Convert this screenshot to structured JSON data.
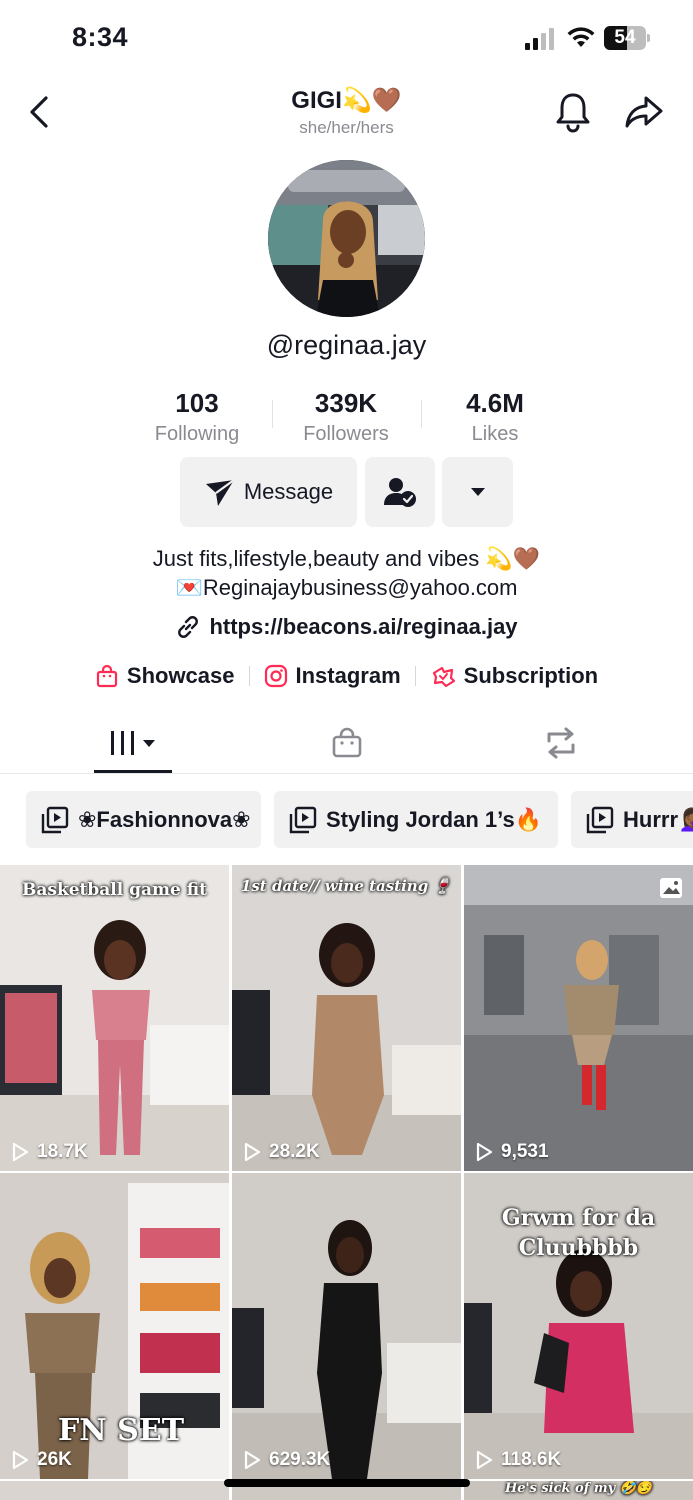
{
  "status_bar": {
    "time": "8:34",
    "battery": "54",
    "battery_level": 0.54
  },
  "header": {
    "title": "GIGI💫🤎",
    "pronouns": "she/her/hers"
  },
  "profile": {
    "username": "@reginaa.jay"
  },
  "stats": [
    {
      "value": "103",
      "label": "Following"
    },
    {
      "value": "339K",
      "label": "Followers"
    },
    {
      "value": "4.6M",
      "label": "Likes"
    }
  ],
  "actions": {
    "message_label": "Message"
  },
  "bio": {
    "line1": "Just fits,lifestyle,beauty and vibes 💫🤎",
    "line2": "💌Reginajaybusiness@yahoo.com",
    "link": "https://beacons.ai/reginaa.jay"
  },
  "links": [
    {
      "label": "Showcase",
      "icon": "shopping-bag-icon"
    },
    {
      "label": "Instagram",
      "icon": "instagram-icon"
    },
    {
      "label": "Subscription",
      "icon": "subscription-icon"
    }
  ],
  "tabs": [
    {
      "name": "videos",
      "icon": "grid-icon",
      "active": true
    },
    {
      "name": "shop",
      "icon": "shopping-bag-icon",
      "active": false
    },
    {
      "name": "reposts",
      "icon": "repost-icon",
      "active": false
    }
  ],
  "playlists": [
    "❀Fashionnova❀",
    "Styling Jordan 1’s🔥",
    "Hurrr🤦🏾‍♀️"
  ],
  "videos": [
    {
      "views": "18.7K",
      "overlay": "Basketball game fit"
    },
    {
      "views": "28.2K",
      "overlay": "1st date// wine tasting 🍷"
    },
    {
      "views": "9,531",
      "overlay": ""
    },
    {
      "views": "26K",
      "overlay": "FN SET"
    },
    {
      "views": "629.3K",
      "overlay": ""
    },
    {
      "views": "118.6K",
      "overlay": "Grwm for da Cluubbbb"
    },
    {
      "views": "",
      "overlay": "He's sick of my 🤣😏"
    }
  ],
  "colors": {
    "accent": "#fe2c55",
    "text": "#161823",
    "muted": "#8a8b91",
    "button_bg": "#f1f1f2"
  }
}
